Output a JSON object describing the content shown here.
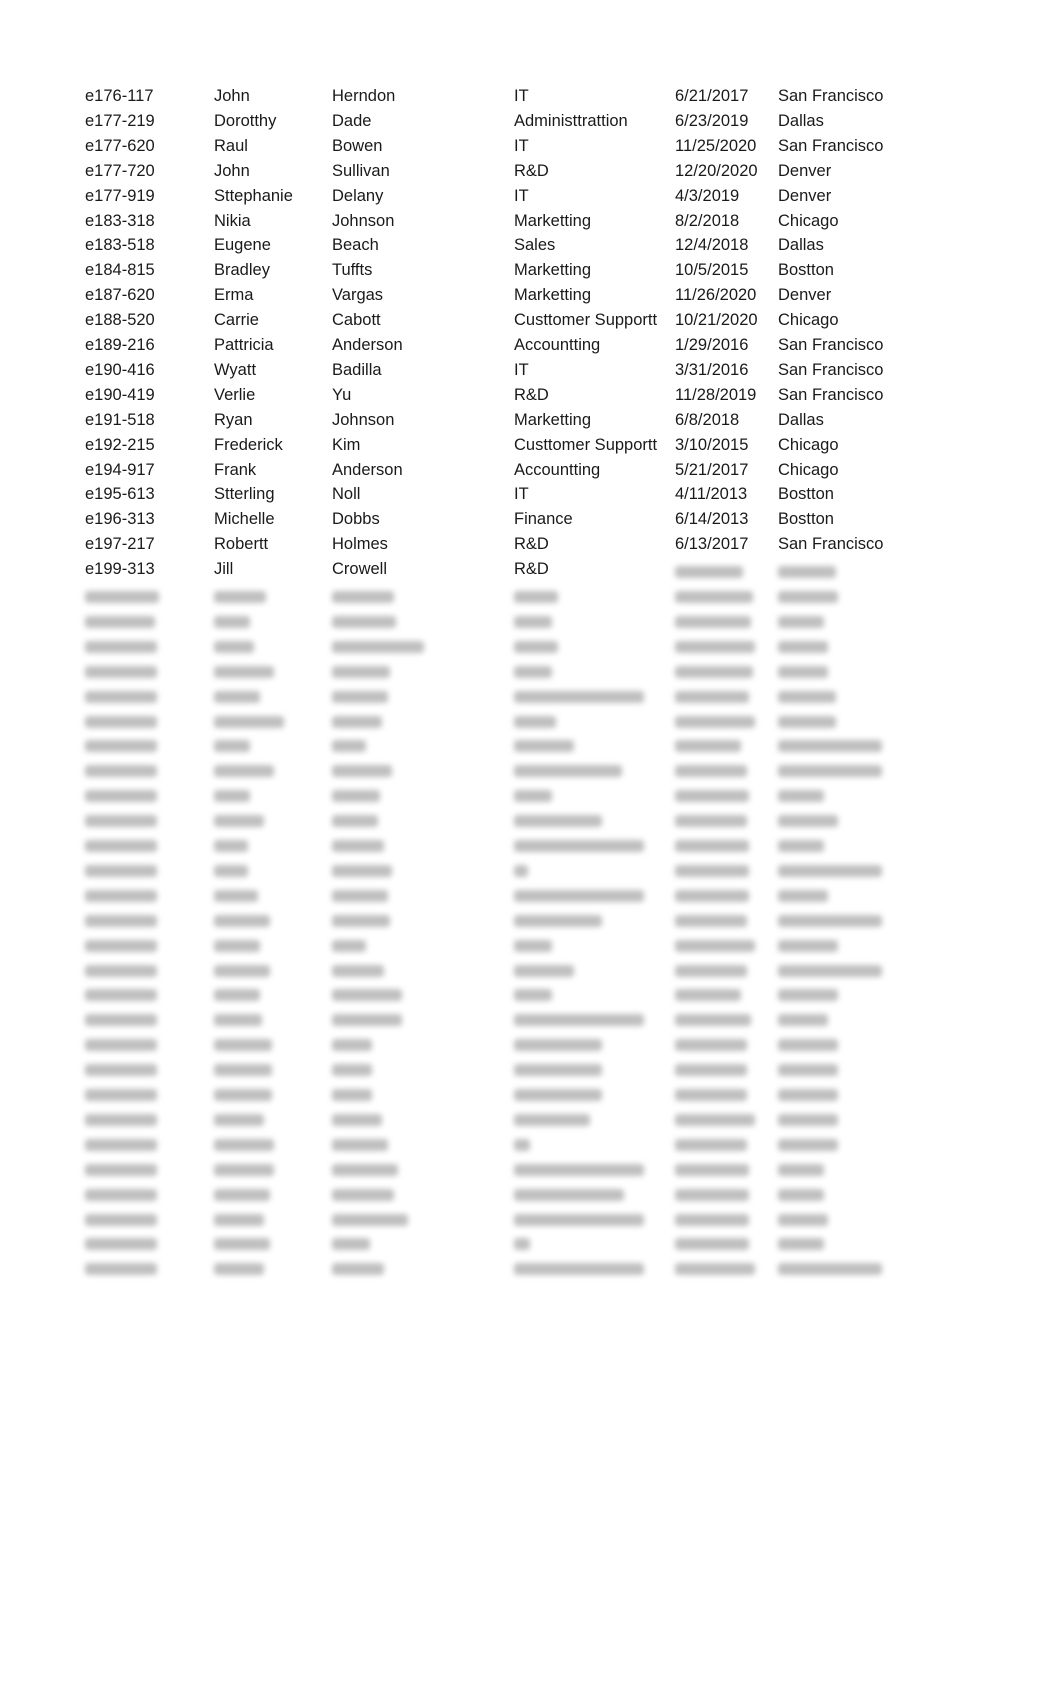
{
  "rows": [
    [
      "e176-117",
      "John",
      "Herndon",
      "IT",
      "6/21/2017",
      "San Francisco"
    ],
    [
      "e177-219",
      "Dorotthy",
      "Dade",
      "Administtrattion",
      "6/23/2019",
      "Dallas"
    ],
    [
      "e177-620",
      "Raul",
      "Bowen",
      "IT",
      "11/25/2020",
      "San Francisco"
    ],
    [
      "e177-720",
      "John",
      "Sullivan",
      "R&D",
      "12/20/2020",
      "Denver"
    ],
    [
      "e177-919",
      "Sttephanie",
      "Delany",
      "IT",
      "4/3/2019",
      "Denver"
    ],
    [
      "e183-318",
      "Nikia",
      "Johnson",
      "Marketting",
      "8/2/2018",
      "Chicago"
    ],
    [
      "e183-518",
      "Eugene",
      "Beach",
      "Sales",
      "12/4/2018",
      "Dallas"
    ],
    [
      "e184-815",
      "Bradley",
      "Tuffts",
      "Marketting",
      "10/5/2015",
      "Bostton"
    ],
    [
      "e187-620",
      "Erma",
      "Vargas",
      "Marketting",
      "11/26/2020",
      "Denver"
    ],
    [
      "e188-520",
      "Carrie",
      "Cabott",
      "Custtomer Supportt",
      "10/21/2020",
      "Chicago"
    ],
    [
      "e189-216",
      "Pattricia",
      "Anderson",
      "Accountting",
      "1/29/2016",
      "San Francisco"
    ],
    [
      "e190-416",
      "Wyatt",
      "Badilla",
      "IT",
      "3/31/2016",
      "San Francisco"
    ],
    [
      "e190-419",
      "Verlie",
      "Yu",
      "R&D",
      "11/28/2019",
      "San Francisco"
    ],
    [
      "e191-518",
      "Ryan",
      "Johnson",
      "Marketting",
      "6/8/2018",
      "Dallas"
    ],
    [
      "e192-215",
      "Frederick",
      "Kim",
      "Custtomer Supportt",
      "3/10/2015",
      "Chicago"
    ],
    [
      "e194-917",
      "Frank",
      "Anderson",
      "Accountting",
      "5/21/2017",
      "Chicago"
    ],
    [
      "e195-613",
      "Stterling",
      "Noll",
      "IT",
      "4/11/2013",
      "Bostton"
    ],
    [
      "e196-313",
      "Michelle",
      "Dobbs",
      "Finance",
      "6/14/2013",
      "Bostton"
    ],
    [
      "e197-217",
      "Robertt",
      "Holmes",
      "R&D",
      "6/13/2017",
      "San Francisco"
    ],
    [
      "e199-313",
      "Jill",
      "Crowell",
      "R&D",
      null,
      null
    ]
  ]
}
